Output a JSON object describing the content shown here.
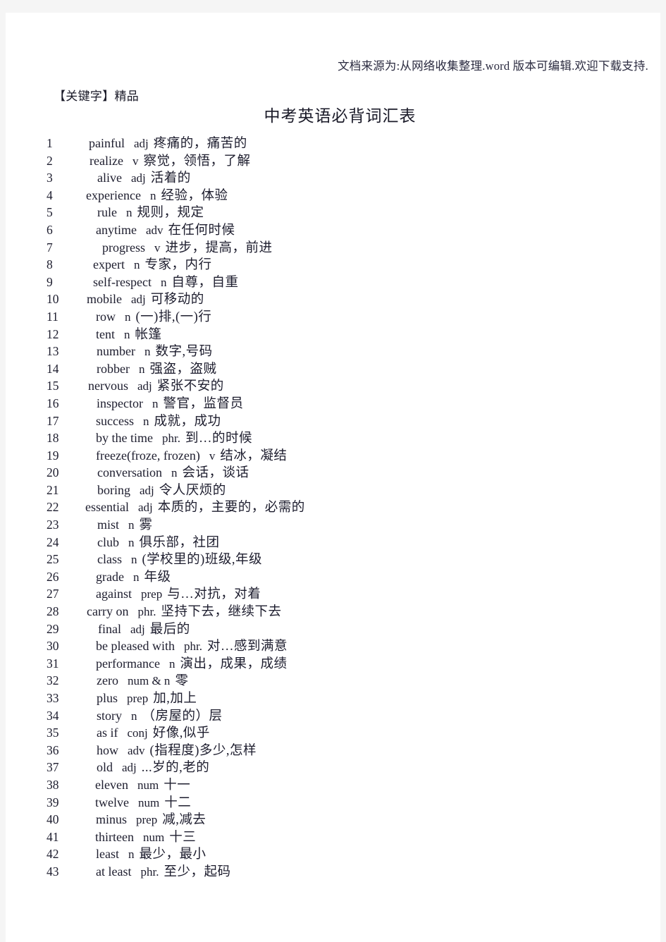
{
  "header": {
    "source_note": "文档来源为:从网络收集整理.word 版本可编辑.欢迎下载支持.",
    "keyword_tag": "【关键字】精品",
    "title": "中考英语必背词汇表"
  },
  "colors": {
    "page_background": "#ffffff",
    "outer_background": "#f5f5f5",
    "text": "#1d1d2e",
    "source_note": "#2b2b40"
  },
  "word_list": [
    {
      "num": "1",
      "word": "painful",
      "pos": "adj",
      "def": "疼痛的，痛苦的",
      "indent": 118
    },
    {
      "num": "2",
      "word": "realize",
      "pos": "v",
      "def": "察觉，领悟，了解",
      "indent": 119
    },
    {
      "num": "3",
      "word": "alive",
      "pos": "adj",
      "def": "活着的",
      "indent": 130
    },
    {
      "num": "4",
      "word": "experience",
      "pos": "n",
      "def": "经验，体验",
      "indent": 114
    },
    {
      "num": "5",
      "word": "rule",
      "pos": "n",
      "def": "规则，规定",
      "indent": 130
    },
    {
      "num": "6",
      "word": "anytime",
      "pos": "adv",
      "def": "在任何时候",
      "indent": 128
    },
    {
      "num": "7",
      "word": "progress",
      "pos": "v",
      "def": "进步，提高，前进",
      "indent": 137
    },
    {
      "num": "8",
      "word": "expert",
      "pos": "n",
      "def": "专家，内行",
      "indent": 124
    },
    {
      "num": "9",
      "word": "self-respect",
      "pos": "n",
      "def": "自尊，自重",
      "indent": 124
    },
    {
      "num": "10",
      "word": "mobile",
      "pos": "adj",
      "def": "可移动的",
      "indent": 115
    },
    {
      "num": "11",
      "word": "row",
      "pos": "n",
      "def": "(一)排,(一)行",
      "indent": 128
    },
    {
      "num": "12",
      "word": "tent",
      "pos": "n",
      "def": "帐篷",
      "indent": 128
    },
    {
      "num": "13",
      "word": "number",
      "pos": "n",
      "def": "数字,号码",
      "indent": 129
    },
    {
      "num": "14",
      "word": "robber",
      "pos": "n",
      "def": "强盗，盗贼",
      "indent": 129
    },
    {
      "num": "15",
      "word": "nervous",
      "pos": "adj",
      "def": "紧张不安的",
      "indent": 117
    },
    {
      "num": "16",
      "word": "inspector",
      "pos": "n",
      "def": "警官，监督员",
      "indent": 129
    },
    {
      "num": "17",
      "word": "success",
      "pos": "n",
      "def": "成就，成功",
      "indent": 128
    },
    {
      "num": "18",
      "word": "by the time",
      "pos": "phr.",
      "def": "到…的时候",
      "indent": 128
    },
    {
      "num": "19",
      "word": "freeze(froze, frozen)",
      "pos": "v",
      "def": "结冰，凝结",
      "indent": 128
    },
    {
      "num": "20",
      "word": "conversation",
      "pos": "n",
      "def": "会话，谈话",
      "indent": 130
    },
    {
      "num": "21",
      "word": "boring",
      "pos": "adj",
      "def": "令人厌烦的",
      "indent": 130
    },
    {
      "num": "22",
      "word": "essential",
      "pos": "adj",
      "def": "本质的，主要的，必需的",
      "indent": 113
    },
    {
      "num": "23",
      "word": "mist",
      "pos": "n",
      "def": "雾",
      "indent": 130
    },
    {
      "num": "24",
      "word": "club",
      "pos": "n",
      "def": "俱乐部，社团",
      "indent": 130
    },
    {
      "num": "25",
      "word": "class",
      "pos": "n",
      "def": "(学校里的)班级,年级",
      "indent": 130
    },
    {
      "num": "26",
      "word": "grade",
      "pos": "n",
      "def": "年级",
      "indent": 128
    },
    {
      "num": "27",
      "word": "against",
      "pos": "prep",
      "def": "与…对抗，对着",
      "indent": 128
    },
    {
      "num": "28",
      "word": "carry on",
      "pos": "phr.",
      "def": "坚持下去，继续下去",
      "indent": 115
    },
    {
      "num": "29",
      "word": "final",
      "pos": "adj",
      "def": "最后的",
      "indent": 131
    },
    {
      "num": "30",
      "word": "be pleased with",
      "pos": "phr.",
      "def": "对…感到满意",
      "indent": 128
    },
    {
      "num": "31",
      "word": "performance",
      "pos": "n",
      "def": "演出，成果，成绩",
      "indent": 128
    },
    {
      "num": "32",
      "word": "zero",
      "pos": "num & n",
      "def": "零",
      "indent": 129
    },
    {
      "num": "33",
      "word": "plus",
      "pos": "prep",
      "def": "加,加上",
      "indent": 129
    },
    {
      "num": "34",
      "word": "story",
      "pos": "n",
      "def": "（房屋的）层",
      "indent": 129
    },
    {
      "num": "35",
      "word": "as if",
      "pos": "conj",
      "def": "好像,似乎",
      "indent": 129
    },
    {
      "num": "36",
      "word": "how",
      "pos": "adv",
      "def": "(指程度)多少,怎样",
      "indent": 129
    },
    {
      "num": "37",
      "word": "old",
      "pos": "adj",
      "def": "...岁的,老的",
      "indent": 129
    },
    {
      "num": "38",
      "word": "eleven",
      "pos": "num",
      "def": "十一",
      "indent": 127
    },
    {
      "num": "39",
      "word": "twelve",
      "pos": "num",
      "def": "十二",
      "indent": 127
    },
    {
      "num": "40",
      "word": "minus",
      "pos": "prep",
      "def": "减,减去",
      "indent": 128
    },
    {
      "num": "41",
      "word": "thirteen",
      "pos": "num",
      "def": "十三",
      "indent": 127
    },
    {
      "num": "42",
      "word": "least",
      "pos": "n",
      "def": "最少，最小",
      "indent": 128
    },
    {
      "num": "43",
      "word": "at least",
      "pos": "phr.",
      "def": "至少，起码",
      "indent": 128
    }
  ]
}
